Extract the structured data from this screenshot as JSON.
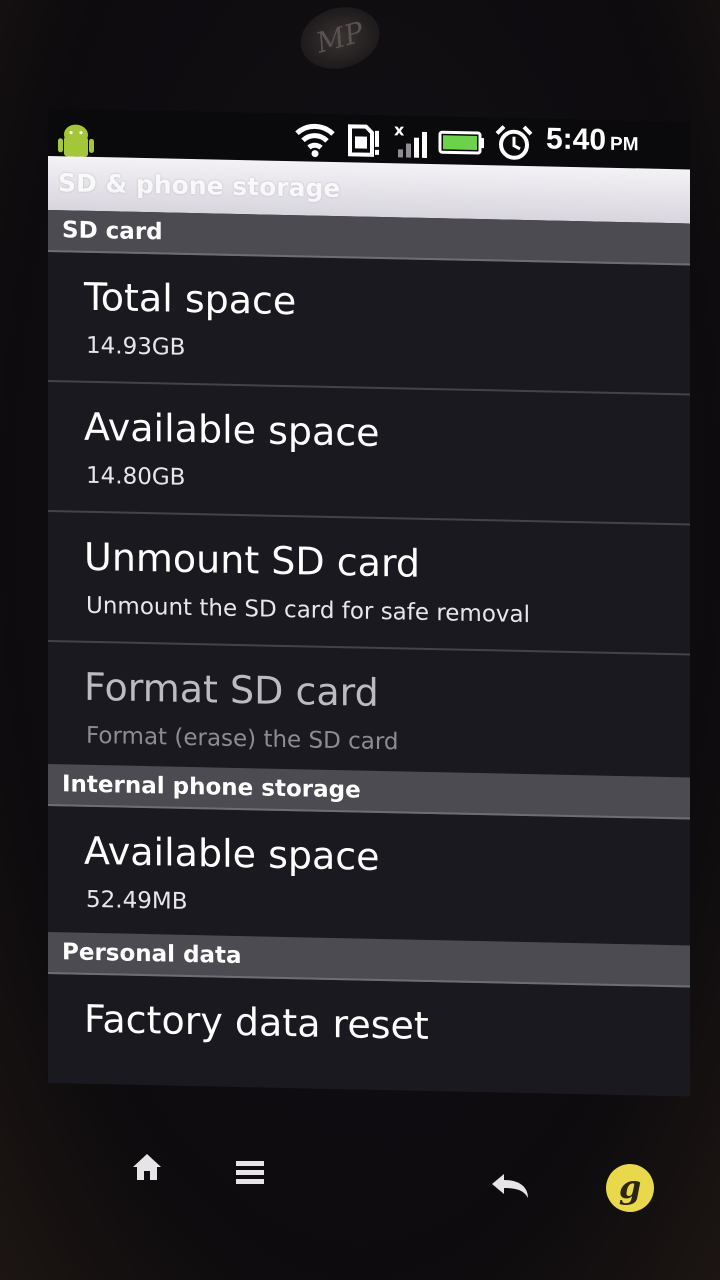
{
  "device": {
    "logo_text": "MP"
  },
  "status_bar": {
    "time": "5:40",
    "ampm": "PM",
    "icons": [
      "android-notification-icon",
      "wifi-icon",
      "sd-card-icon",
      "signal-icon",
      "battery-icon",
      "alarm-icon"
    ]
  },
  "title_bar": {
    "title": "SD & phone storage"
  },
  "sections": {
    "sd_card": {
      "header": "SD card",
      "total_space": {
        "title": "Total space",
        "summary": "14.93GB"
      },
      "available_space": {
        "title": "Available space",
        "summary": "14.80GB"
      },
      "unmount": {
        "title": "Unmount SD card",
        "summary": "Unmount the SD card for safe removal"
      },
      "format": {
        "title": "Format SD card",
        "summary": "Format (erase) the SD card",
        "enabled": false
      }
    },
    "internal": {
      "header": "Internal phone storage",
      "available_space": {
        "title": "Available space",
        "summary": "52.49MB"
      }
    },
    "personal": {
      "header": "Personal data",
      "factory_reset": {
        "title": "Factory data reset"
      }
    }
  },
  "hardware_keys": {
    "home": "home-icon",
    "menu": "menu-icon",
    "back": "back-icon",
    "search": "search-g-icon",
    "search_glyph": "g"
  },
  "colors": {
    "section_header_bg": "#4c4b52",
    "list_bg": "#1b1920",
    "battery_green": "#6cd24a",
    "title_bar_bg": "#e6e3ea"
  }
}
